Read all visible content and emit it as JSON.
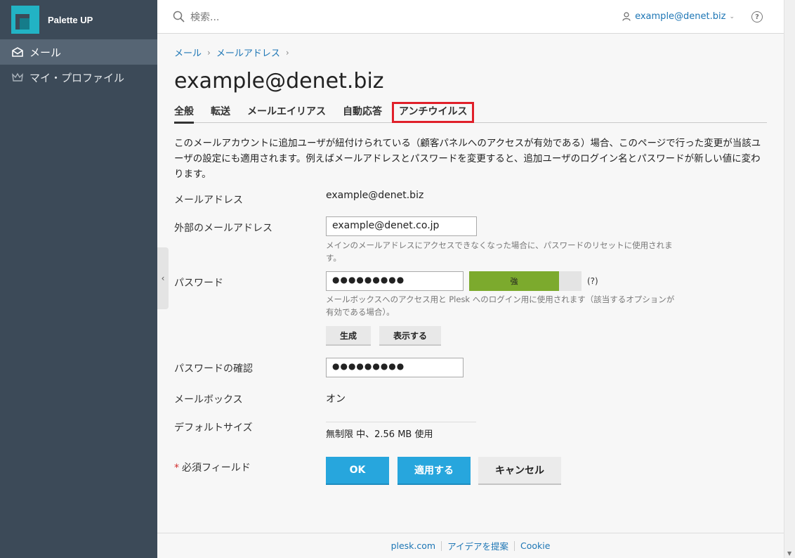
{
  "brand": {
    "name": "Palette UP"
  },
  "sidebar": {
    "items": [
      {
        "label": "メール",
        "icon": "mail-icon",
        "active": true
      },
      {
        "label": "マイ・プロファイル",
        "icon": "crown-icon",
        "active": false
      }
    ]
  },
  "header": {
    "search_placeholder": "検索...",
    "user": "example@denet.biz",
    "help": "?"
  },
  "breadcrumb": {
    "items": [
      "メール",
      "メールアドレス"
    ]
  },
  "page_title": "example@denet.biz",
  "tabs": [
    {
      "label": "全般",
      "active": true
    },
    {
      "label": "転送"
    },
    {
      "label": "メールエイリアス"
    },
    {
      "label": "自動応答"
    },
    {
      "label": "アンチウイルス",
      "highlighted": true
    }
  ],
  "description": "このメールアカウントに追加ユーザが紐付けられている（顧客パネルへのアクセスが有効である）場合、このページで行った変更が当該ユーザの設定にも適用されます。例えばメールアドレスとパスワードを変更すると、追加ユーザのログイン名とパスワードが新しい値に変わります。",
  "form": {
    "email_label": "メールアドレス",
    "email_value": "example@denet.biz",
    "external_label": "外部のメールアドレス",
    "external_value": "example@denet.co.jp",
    "external_hint": "メインのメールアドレスにアクセスできなくなった場合に、パスワードのリセットに使用されます。",
    "password_label": "パスワード",
    "password_value": "●●●●●●●●●",
    "strength_label": "強",
    "strength_fraction": 0.8,
    "strength_help": "(?)",
    "password_hint": "メールボックスへのアクセス用と Plesk へのログイン用に使用されます（該当するオプションが有効である場合）。",
    "generate_label": "生成",
    "show_label": "表示する",
    "confirm_label": "パスワードの確認",
    "confirm_value": "●●●●●●●●●",
    "mailbox_label": "メールボックス",
    "mailbox_value": "オン",
    "size_label": "デフォルトサイズ",
    "size_value": "無制限 中、2.56 MB 使用",
    "required_label": "必須フィールド",
    "required_star": "*"
  },
  "actions": {
    "ok": "OK",
    "apply": "適用する",
    "cancel": "キャンセル"
  },
  "footer": {
    "links": [
      "plesk.com",
      "アイデアを提案",
      "Cookie"
    ]
  },
  "colors": {
    "sidebar": "#3c4a58",
    "accent": "#27a6dd",
    "link": "#1d76b5",
    "strength": "#7caa2d",
    "highlight": "#e0202a"
  }
}
